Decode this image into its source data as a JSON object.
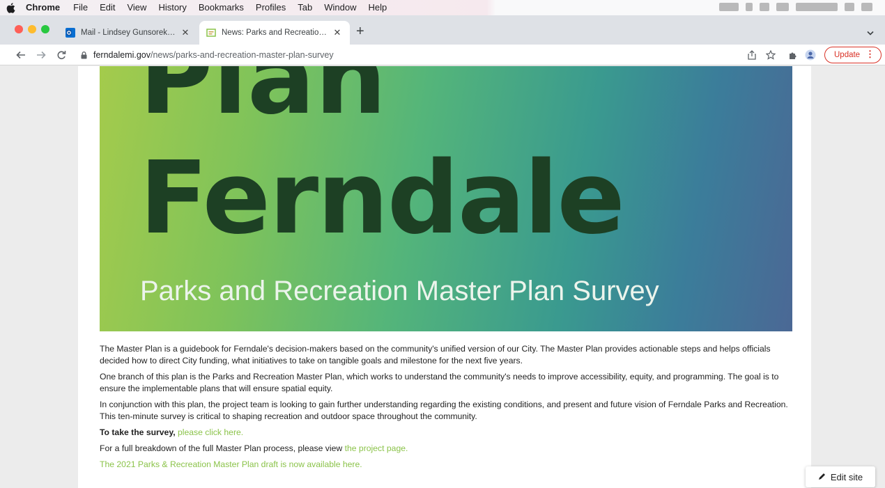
{
  "menubar": {
    "app_name": "Chrome",
    "items": [
      "File",
      "Edit",
      "View",
      "History",
      "Bookmarks",
      "Profiles",
      "Tab",
      "Window",
      "Help"
    ]
  },
  "tabs": [
    {
      "title": "Mail - Lindsey Gunsorek - Outl",
      "close": "✕",
      "icon": "outlook-icon"
    },
    {
      "title": "News: Parks and Recreation M",
      "close": "✕",
      "icon": "ferndale-favicon"
    }
  ],
  "newtab": "+",
  "toolbar": {
    "url_host": "ferndalemi.gov",
    "url_path": "/news/parks-and-recreation-master-plan-survey",
    "update_label": "Update",
    "update_dots": "⋮"
  },
  "hero": {
    "line1": "Plan",
    "line2": "Ferndale",
    "subtitle": "Parks and Recreation Master Plan Survey"
  },
  "article": {
    "p1": "The Master Plan is a guidebook for Ferndale's decision-makers based on the community's unified version of our City. The Master Plan provides actionable steps and helps officials decided how to direct City funding, what initiatives to take on tangible goals and milestone for the next five years.",
    "p2": "One branch of this plan is the Parks and Recreation Master Plan, which works to understand the community's needs to improve accessibility, equity, and programming. The goal is to ensure the implementable plans that will ensure spatial equity.",
    "p3": "In conjunction with this plan, the project team is looking to gain further understanding regarding the existing conditions, and present and future vision of Ferndale Parks and Recreation. This ten-minute survey is critical to shaping recreation and outdoor space throughout the community.",
    "survey_lead": "To take the survey,",
    "survey_link": "please click here.",
    "breakdown_text": "For a full breakdown of the full Master Plan process, please view",
    "breakdown_link": "the project page.",
    "draft_link": "The 2021 Parks & Recreation Master Plan draft is now available here."
  },
  "edit_site_label": "Edit site",
  "colors": {
    "link": "#8bc34a",
    "hero_text": "#1d4024",
    "update_red": "#d93025"
  }
}
